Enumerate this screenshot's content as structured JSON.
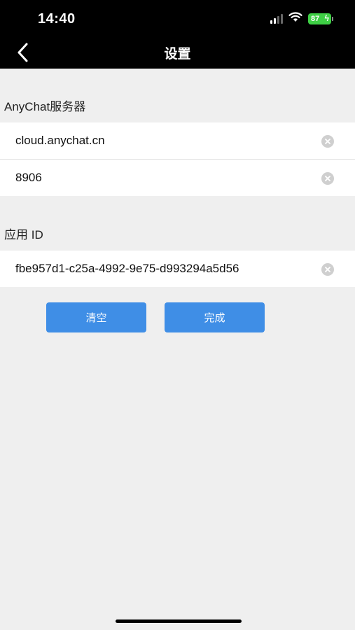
{
  "status": {
    "time": "14:40",
    "battery": "87"
  },
  "nav": {
    "title": "设置"
  },
  "server_section": {
    "label": "AnyChat服务器",
    "address_value": "cloud.anychat.cn",
    "port_value": "8906"
  },
  "app_section": {
    "label": "应用 ID",
    "app_id_value": "fbe957d1-c25a-4992-9e75-d993294a5d56"
  },
  "buttons": {
    "clear_label": "清空",
    "done_label": "完成"
  },
  "colors": {
    "accent": "#3f8ee6",
    "header_bg": "#000000",
    "page_bg": "#efefef"
  }
}
